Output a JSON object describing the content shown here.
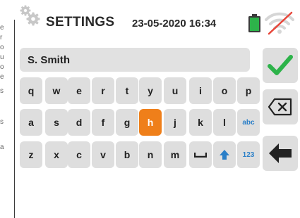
{
  "header": {
    "title": "SETTINGS",
    "datetime": "23-05-2020 16:34",
    "icons": {
      "settings": "gear-icon",
      "battery": "battery-full-icon",
      "wireless": "wifi-off-icon"
    },
    "battery_color": "#2db34a"
  },
  "input": {
    "value": "S. Smith",
    "placeholder": ""
  },
  "keyboard": {
    "row1": [
      "q",
      "w",
      "e",
      "r",
      "t",
      "y",
      "u",
      "i",
      "o",
      "p"
    ],
    "row2": [
      "a",
      "s",
      "d",
      "f",
      "g",
      "h",
      "j",
      "k",
      "l"
    ],
    "row2_mode": "abc",
    "row3": [
      "z",
      "x",
      "c",
      "v",
      "b",
      "n",
      "m"
    ],
    "row3_mode": "123",
    "space_icon": "space-bar-icon",
    "shift_icon": "shift-up-arrow-icon",
    "selected_key": "h",
    "selected_color": "#ef7f1a"
  },
  "actions": {
    "confirm_icon": "checkmark-icon",
    "backspace_icon": "backspace-icon",
    "back_icon": "left-arrow-icon",
    "confirm_color": "#2db34a"
  }
}
